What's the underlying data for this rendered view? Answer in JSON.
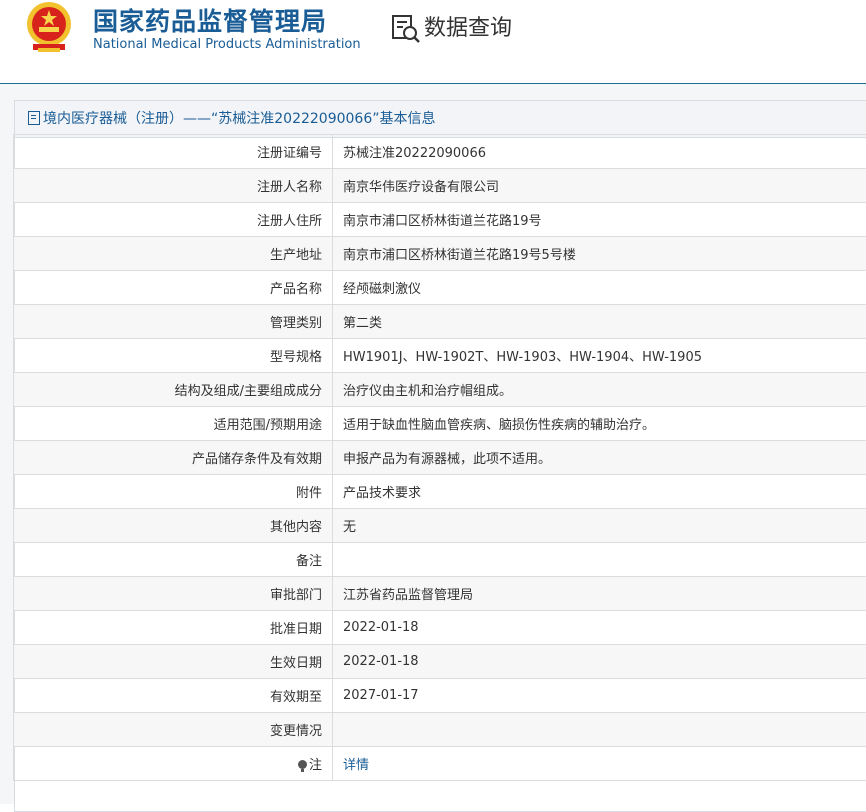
{
  "header": {
    "title_cn": "国家药品监督管理局",
    "title_en": "National Medical Products Administration",
    "search_label": "数据查询",
    "emblem_icon": "national-emblem-icon",
    "search_icon": "document-search-icon"
  },
  "panel": {
    "title": "境内医疗器械（注册）——“苏械注准20222090066”基本信息",
    "title_icon": "document-icon"
  },
  "rows": [
    {
      "label": "注册证编号",
      "value": "苏械注准20222090066"
    },
    {
      "label": "注册人名称",
      "value": "南京华伟医疗设备有限公司"
    },
    {
      "label": "注册人住所",
      "value": "南京市浦口区桥林街道兰花路19号"
    },
    {
      "label": "生产地址",
      "value": "南京市浦口区桥林街道兰花路19号5号楼"
    },
    {
      "label": "产品名称",
      "value": "经颅磁刺激仪"
    },
    {
      "label": "管理类别",
      "value": "第二类"
    },
    {
      "label": "型号规格",
      "value": "HW1901J、HW-1902T、HW-1903、HW-1904、HW-1905"
    },
    {
      "label": "结构及组成/主要组成成分",
      "value": "治疗仪由主机和治疗帽组成。"
    },
    {
      "label": "适用范围/预期用途",
      "value": "适用于缺血性脑血管疾病、脑损伤性疾病的辅助治疗。"
    },
    {
      "label": "产品储存条件及有效期",
      "value": "申报产品为有源器械，此项不适用。"
    },
    {
      "label": "附件",
      "value": "产品技术要求"
    },
    {
      "label": "其他内容",
      "value": "无"
    },
    {
      "label": "备注",
      "value": ""
    },
    {
      "label": "审批部门",
      "value": "江苏省药品监督管理局"
    },
    {
      "label": "批准日期",
      "value": "2022-01-18"
    },
    {
      "label": "生效日期",
      "value": "2022-01-18"
    },
    {
      "label": "有效期至",
      "value": "2027-01-17"
    },
    {
      "label": "变更情况",
      "value": ""
    },
    {
      "label": "注",
      "value": "详情",
      "icon": "lightbulb-icon"
    }
  ],
  "colors": {
    "brand_blue": "#1a5d96",
    "link_blue": "#1a5d96"
  }
}
